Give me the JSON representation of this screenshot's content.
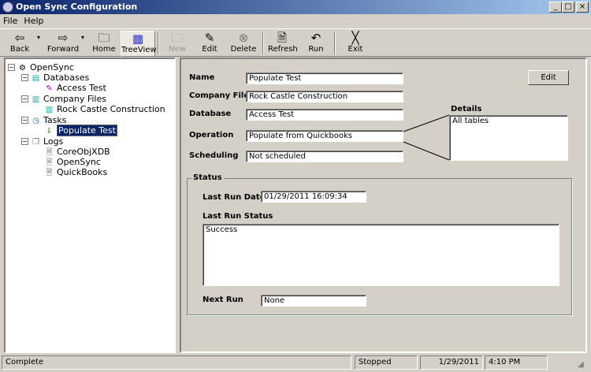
{
  "window": {
    "title": "Open Sync Configuration",
    "buttons": [
      "_",
      "□",
      "×"
    ]
  },
  "menu": [
    "File",
    "Help"
  ],
  "toolbar": {
    "back": "Back",
    "forward": "Forward",
    "home": "Home",
    "treeview": "TreeView",
    "new": "New",
    "edit": "Edit",
    "delete": "Delete",
    "refresh": "Refresh",
    "run": "Run",
    "exit": "Exit"
  },
  "tree": {
    "root": "OpenSync",
    "databases": "Databases",
    "access_test": "Access Test",
    "company_files": "Company Files",
    "rock_castle": "Rock Castle Construction",
    "tasks": "Tasks",
    "populate_test": "Populate Test",
    "logs": "Logs",
    "log_items": [
      "CoreObjXDB",
      "OpenSync",
      "QuickBooks"
    ]
  },
  "form": {
    "name_label": "Name",
    "name": "Populate Test",
    "company_label": "Company File",
    "company": "Rock Castle Construction",
    "database_label": "Database",
    "database": "Access Test",
    "operation_label": "Operation",
    "operation": "Populate from Quickbooks",
    "scheduling_label": "Scheduling",
    "scheduling": "Not scheduled",
    "edit_button": "Edit",
    "details_label": "Details",
    "details": "All tables"
  },
  "status_group": {
    "title": "Status",
    "last_run_date_label": "Last Run Date",
    "last_run_date": "01/29/2011 16:09:34",
    "last_run_status_label": "Last Run Status",
    "last_run_status": "Success",
    "next_run_label": "Next Run",
    "next_run": "None"
  },
  "statusbar": {
    "message": "Complete",
    "state": "Stopped",
    "date": "1/29/2011",
    "time": "4:10 PM"
  }
}
